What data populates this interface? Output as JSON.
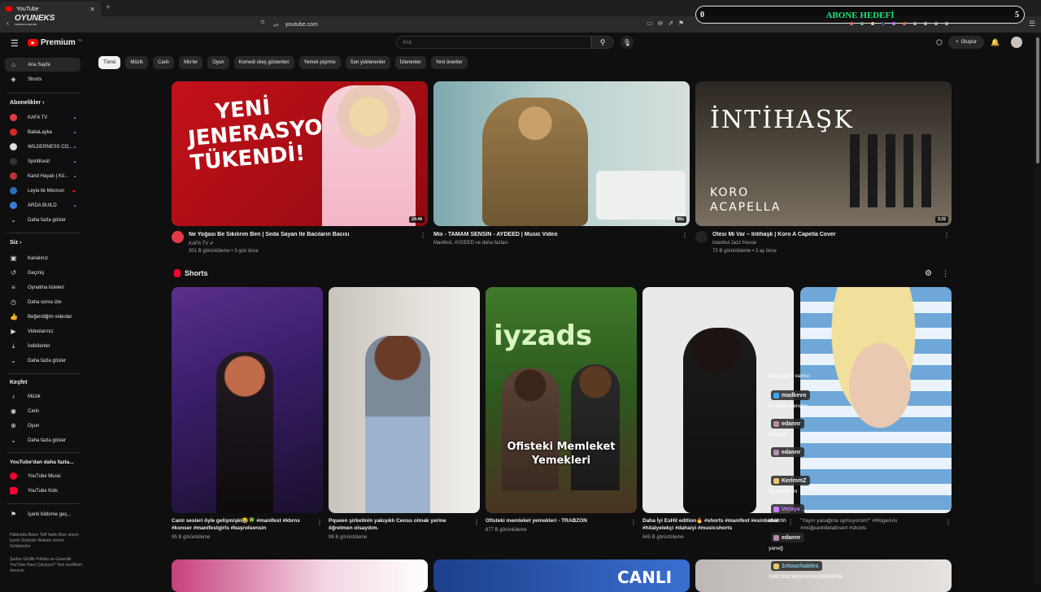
{
  "browser": {
    "tab_title": "YouTube",
    "url": "youtube.com",
    "overlay_logo": "OYUNEKS",
    "overlay_logo_sub": "KENDİNLE GEÇME"
  },
  "abone": {
    "title": "ABONE HEDEFİ",
    "start": "0",
    "end": "5",
    "progress": 0.1
  },
  "header": {
    "logo": "Premium",
    "logo_tr": "TR",
    "search_placeholder": "Ara",
    "create_label": "Oluştur"
  },
  "sidebar": {
    "main": [
      {
        "label": "Ana Sayfa",
        "icon": "home-icon"
      },
      {
        "label": "Shorts",
        "icon": "shorts-icon"
      }
    ],
    "subs_title": "Abonelikler",
    "subs": [
      {
        "label": "KAFA TV",
        "color": "#e63946"
      },
      {
        "label": "BabaLayka",
        "color": "#d62828"
      },
      {
        "label": "WILDERNESS CO...",
        "color": "#dddddd"
      },
      {
        "label": "SpiritKesit",
        "color": "#333333"
      },
      {
        "label": "Kand Hayatı | Kö...",
        "color": "#b33"
      },
      {
        "label": "Leyla ile Mecnun",
        "color": "#2a6fb5"
      },
      {
        "label": "ARDA BUILD",
        "color": "#3a7bd5"
      }
    ],
    "more_subs": "Daha fazla göster",
    "you_title": "Siz",
    "you": [
      {
        "label": "Kanalınız",
        "icon": "channel-icon"
      },
      {
        "label": "Geçmiş",
        "icon": "history-icon"
      },
      {
        "label": "Oynatma listeleri",
        "icon": "playlist-icon"
      },
      {
        "label": "Daha sonra izle",
        "icon": "clock-icon"
      },
      {
        "label": "Beğendiğim videolar",
        "icon": "like-icon"
      },
      {
        "label": "Videolarınız",
        "icon": "video-icon"
      },
      {
        "label": "İndirilenler",
        "icon": "download-icon"
      },
      {
        "label": "Daha fazla göster",
        "icon": "chevron-down-icon"
      }
    ],
    "explore_title": "Keşfet",
    "explore": [
      {
        "label": "Müzik",
        "icon": "music-icon"
      },
      {
        "label": "Canlı",
        "icon": "live-icon"
      },
      {
        "label": "Oyun",
        "icon": "game-icon"
      },
      {
        "label": "Daha fazla göster",
        "icon": "chevron-down-icon"
      }
    ],
    "more_title": "YouTube'dan daha fazla...",
    "more": [
      {
        "label": "YouTube Music"
      },
      {
        "label": "YouTube Kids"
      }
    ],
    "report": "İçerik bildirme geç...",
    "footer1": "Hakkında  Basın  Telif hakkı  Bize ulaşın  İçerik Üreticiler  Reklam verme  Geliştiriciler",
    "footer2": "Şartlar  Gizlilik  Politika ve Güvenlik  YouTube Nasıl Çalışıyor?  Yeni özellikleri deneyin"
  },
  "chips": [
    "Tümü",
    "Müzik",
    "Canlı",
    "Mix'ler",
    "Oyun",
    "Komedi skeç gösterileri",
    "Yemek pişirme",
    "Son yüklenenler",
    "İzlenenler",
    "Yeni öneriler"
  ],
  "videos": [
    {
      "title": "Ne Yoğası Be Sıkılırım Ben | Seda Sayan İle Bacıların Bacısı",
      "channel": "KAFA TV",
      "meta": "301 B görüntüleme • 3 gün önce",
      "duration": "24:48",
      "thumb_text": "YENİ JENERASYON TÜKENDİ!"
    },
    {
      "title": "Mix - TAMAM SENSİN - AYDEED | Music Video",
      "channel": "Manifest, AYDEED ve daha fazlası",
      "meta": "",
      "duration": "Mix"
    },
    {
      "title": "Ötesi Mi Var – İntihaşk | Koro A Capella Cover",
      "channel": "Istanbul Jazz House",
      "meta": "72 B görüntüleme • 3 ay önce",
      "duration": "3:25",
      "thumb_text": "İNTİHAŞK",
      "thumb_sub": "KORO ACAPELLA"
    }
  ],
  "shorts_title": "Shorts",
  "shorts": [
    {
      "title": "Canlı sesleri öyle gelişmişki😂🍀 #manifest #kbrns #konser #manifestgirls #başrolsensin",
      "views": "95 B görüntüleme"
    },
    {
      "title": "Pqueen şirketinin yakışıklı Ceosu olmak yerine öğretmen olsaydım.",
      "views": "98 B görüntüleme"
    },
    {
      "title": "Ofisteki memleket yemekleri - TRABZON",
      "views": "677 B görüntüleme",
      "overlay": "Ofisteki Memleket Yemekleri",
      "sign": "iyzads"
    },
    {
      "title": "Daha İyi EsHil edition🔥 #shorts #manifest #esinbahat #hilalyelekçi #dahaiyi #musicshorts",
      "views": "645 B görüntüleme"
    },
    {
      "title": "\"Yayın yasağına uymuyorum!\" #MügeAnlı #müğeanlıiletatlısert #shorts",
      "views": ""
    }
  ],
  "bottom": {
    "live": "CANLI"
  },
  "chat": [
    {
      "type": "msg",
      "text": "iiidid yayın varmıı"
    },
    {
      "type": "name",
      "text": "madkevo",
      "color": "#3ea6ff"
    },
    {
      "type": "msg",
      "text": "bu kadın bendim"
    },
    {
      "type": "name",
      "text": "edannr",
      "color": "#b48ead"
    },
    {
      "type": "msg",
      "text": "hghghg"
    },
    {
      "type": "name",
      "text": "edannr",
      "color": "#b48ead"
    },
    {
      "type": "name",
      "text": "KerimmZ",
      "color": "#e9c46a"
    },
    {
      "type": "msg",
      "text": "Bu izlenir mi"
    },
    {
      "type": "name",
      "text": "Veraya",
      "color": "#c77dff"
    },
    {
      "type": "msg",
      "text": "hhhhhh"
    },
    {
      "type": "name",
      "text": "edannr",
      "color": "#b48ead"
    },
    {
      "type": "msg",
      "text": "yaneğ"
    },
    {
      "type": "name",
      "text": "1ntouchables",
      "color": "#e9c46a"
    },
    {
      "type": "msg",
      "text": "SMCNNCMDKDKSKDMDMDM"
    }
  ]
}
